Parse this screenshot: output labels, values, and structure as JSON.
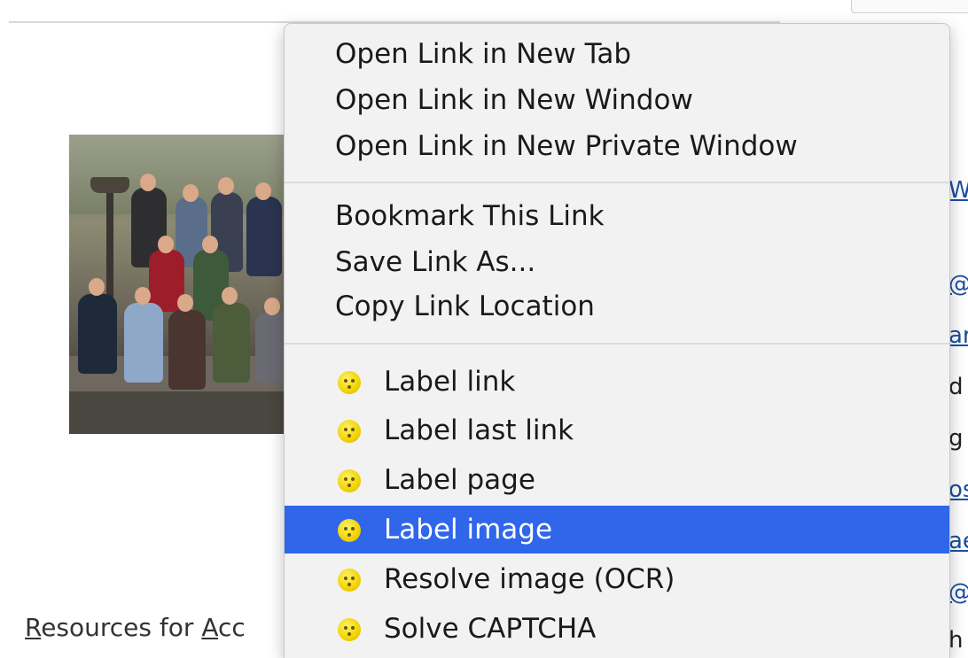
{
  "menu": {
    "items": [
      {
        "label": "Open Link in New Tab"
      },
      {
        "label": "Open Link in New Window"
      },
      {
        "label": "Open Link in New Private Window"
      },
      {
        "label": "Bookmark This Link"
      },
      {
        "label": "Save Link As..."
      },
      {
        "label": "Copy Link Location"
      },
      {
        "label": "Label link",
        "icon": "smiley-icon"
      },
      {
        "label": "Label last link",
        "icon": "smiley-icon"
      },
      {
        "label": "Label page",
        "icon": "smiley-icon"
      },
      {
        "label": "Label image",
        "icon": "smiley-icon",
        "state": "highlighted"
      },
      {
        "label": "Resolve image (OCR)",
        "icon": "smiley-icon"
      },
      {
        "label": "Solve CAPTCHA",
        "icon": "smiley-icon"
      }
    ]
  },
  "background": {
    "footer_text": {
      "r": "R",
      "esources": "esources for ",
      "a": "A",
      "cc": "cc"
    },
    "side_fragments": [
      "W",
      "@",
      "ar",
      "d",
      "g",
      "os",
      "ae",
      "@",
      "h"
    ]
  },
  "colors": {
    "highlight": "#2f66ea",
    "menu_bg": "#f2f2f2",
    "link": "#1a4fa0",
    "icon": "#f1d300"
  }
}
